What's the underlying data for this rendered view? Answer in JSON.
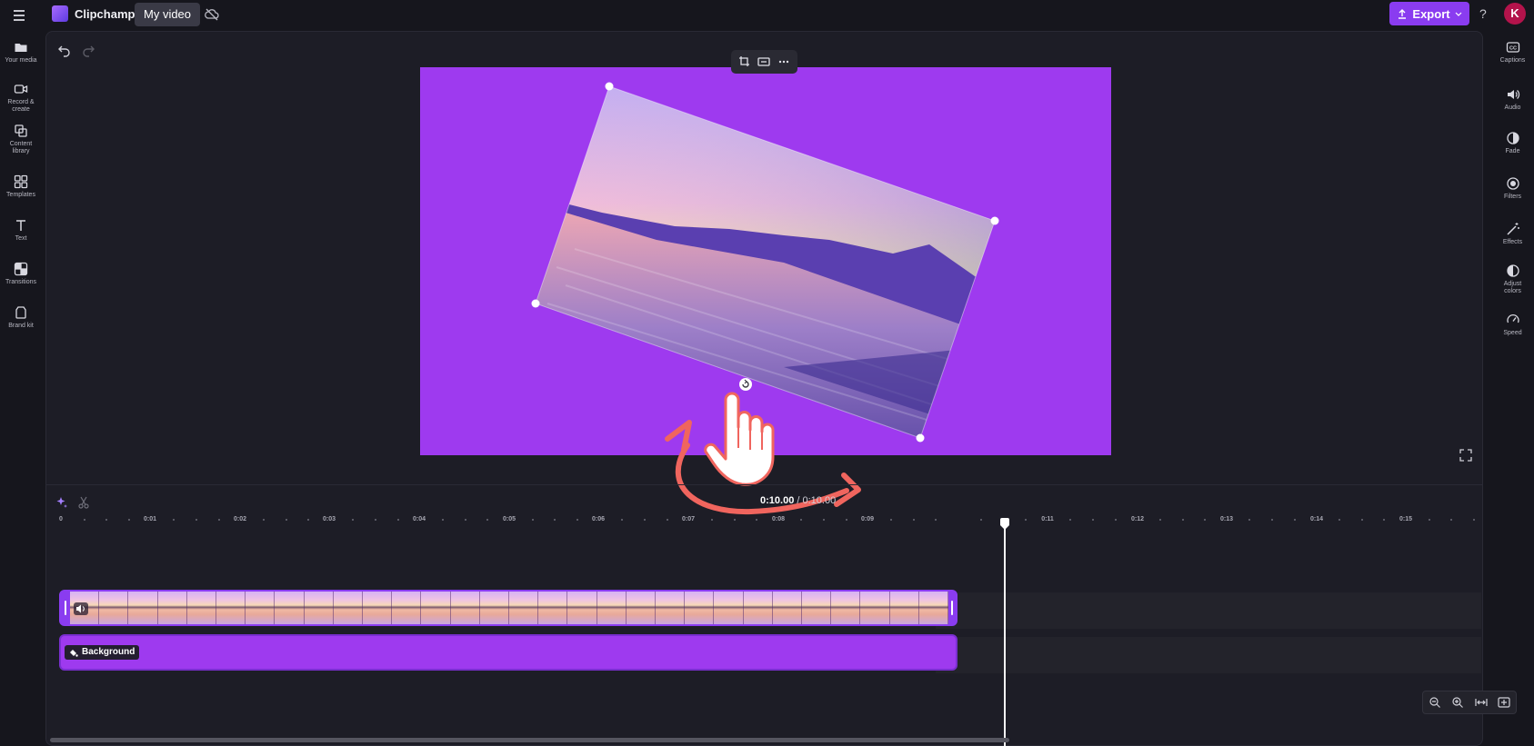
{
  "header": {
    "menu_icon": "hamburger-menu-icon",
    "app_name": "Clipchamp",
    "project_name": "My video",
    "sync_icon": "cloud-off-icon",
    "export_label": "Export",
    "help_label": "?",
    "avatar_initial": "K",
    "accent_color": "#8a3cf0"
  },
  "left_sidebar": {
    "items": [
      {
        "label": "Your media",
        "icon": "folder-icon"
      },
      {
        "label": "Record &",
        "label2": "create",
        "icon": "video-camera-icon"
      },
      {
        "label": "Content",
        "label2": "library",
        "icon": "library-icon"
      },
      {
        "label": "Templates",
        "icon": "templates-icon"
      },
      {
        "label": "Text",
        "icon": "text-icon"
      },
      {
        "label": "Transitions",
        "icon": "transitions-icon"
      },
      {
        "label": "Brand kit",
        "icon": "brand-kit-icon"
      }
    ]
  },
  "right_sidebar": {
    "items": [
      {
        "label": "Captions",
        "icon": "captions-icon"
      },
      {
        "label": "Audio",
        "icon": "speaker-icon"
      },
      {
        "label": "Fade",
        "icon": "fade-icon"
      },
      {
        "label": "Filters",
        "icon": "filters-icon"
      },
      {
        "label": "Effects",
        "icon": "magic-wand-icon"
      },
      {
        "label": "Adjust",
        "label2": "colors",
        "icon": "adjust-colors-icon"
      },
      {
        "label": "Speed",
        "icon": "speedometer-icon"
      }
    ]
  },
  "preview": {
    "background_color": "#9e3aef",
    "toolbar_icons": [
      "crop-icon",
      "fit-icon",
      "more-icon"
    ],
    "rotate_handle_icon": "rotate-icon",
    "overlay_annotation": "rotate-gesture-hand-icon"
  },
  "timeline": {
    "current_time": "0:10.00",
    "separator": "/",
    "total_time": "0:10.00",
    "ruler_labels": [
      "0",
      "0:01",
      "0:02",
      "0:03",
      "0:04",
      "0:05",
      "0:06",
      "0:07",
      "0:08",
      "0:09",
      "0:11",
      "0:12",
      "0:13",
      "0:14",
      "0:15"
    ],
    "background_track_label": "Background",
    "zoom_icons": [
      "zoom-out-icon",
      "zoom-in-icon",
      "fit-timeline-icon",
      "expand-timeline-icon"
    ]
  }
}
